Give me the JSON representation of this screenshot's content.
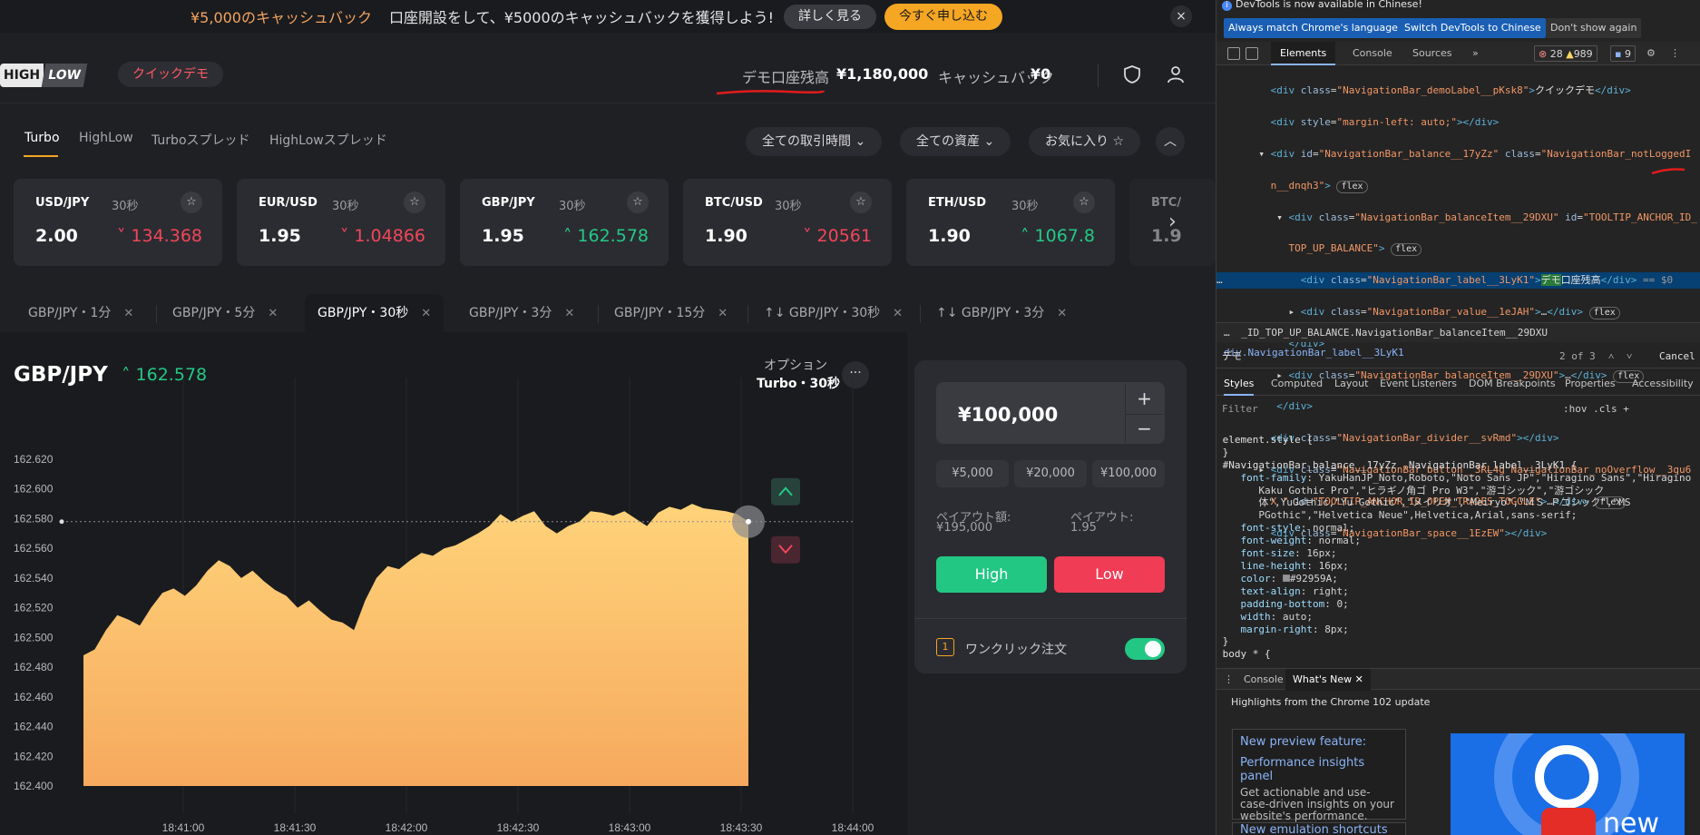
{
  "promo": {
    "cashback_amount": "¥5,000のキャッシュバック",
    "message": "口座開設をして、¥5000のキャッシュバックを獲得しよう!",
    "details_button": "詳しく見る",
    "apply_button": "今すぐ申し込む",
    "close_icon": "×"
  },
  "nav": {
    "logo_left": "HIGH",
    "logo_right": "LOW",
    "demo_label": "クイックデモ",
    "balance_label": "デモ口座残高",
    "balance_value": "¥1,180,000",
    "cashback_label": "キャッシュバック",
    "cashback_value": "¥0",
    "icons": [
      "shield-icon",
      "user-icon"
    ]
  },
  "modes": {
    "items": [
      "Turbo",
      "HighLow",
      "Turboスプレッド",
      "HighLowスプレッド"
    ],
    "active": "Turbo",
    "filters": [
      "全ての取引時間",
      "全ての資産",
      "お気に入り"
    ],
    "filter_icons": [
      "chevron-down-icon",
      "chevron-down-icon",
      "star-icon"
    ]
  },
  "assets": [
    {
      "pair": "USD/JPY",
      "duration": "30秒",
      "payout": "2.00",
      "price": "134.368",
      "direction": "down"
    },
    {
      "pair": "EUR/USD",
      "duration": "30秒",
      "payout": "1.95",
      "price": "1.04866",
      "direction": "down"
    },
    {
      "pair": "GBP/JPY",
      "duration": "30秒",
      "payout": "1.95",
      "price": "162.578",
      "direction": "up"
    },
    {
      "pair": "BTC/USD",
      "duration": "30秒",
      "payout": "1.90",
      "price": "20561",
      "direction": "down"
    },
    {
      "pair": "ETH/USD",
      "duration": "30秒",
      "payout": "1.90",
      "price": "1067.8",
      "direction": "up"
    },
    {
      "pair": "BTC/",
      "duration": "",
      "payout": "1.9",
      "price": "",
      "direction": "down"
    }
  ],
  "tabs": [
    {
      "label": "GBP/JPY・1分",
      "active": false
    },
    {
      "label": "GBP/JPY・5分",
      "active": false
    },
    {
      "label": "GBP/JPY・30秒",
      "active": true
    },
    {
      "label": "GBP/JPY・3分",
      "active": false
    },
    {
      "label": "GBP/JPY・15分",
      "active": false
    },
    {
      "label": "↑↓ GBP/JPY・30秒",
      "active": false
    },
    {
      "label": "↑↓ GBP/JPY・3分",
      "active": false
    }
  ],
  "chart_header": {
    "symbol": "GBP/JPY",
    "price": "162.578",
    "option_label": "オプション",
    "option_value": "Turbo・30秒",
    "more_icon": "···"
  },
  "chart_data": {
    "type": "area",
    "title": "",
    "xlabel": "",
    "ylabel": "",
    "y_ticks": [
      "162.620",
      "162.600",
      "162.580",
      "162.560",
      "162.540",
      "162.520",
      "162.500",
      "162.480",
      "162.460",
      "162.440",
      "162.420",
      "162.400"
    ],
    "x_ticks": [
      "18:41:00",
      "18:41:30",
      "18:42:00",
      "18:42:30",
      "18:43:00",
      "18:43:30",
      "18:44:00"
    ],
    "ylim": [
      162.4,
      162.62
    ],
    "current_price": 162.578,
    "series": [
      {
        "values": [
          162.488,
          162.492,
          162.505,
          162.515,
          162.512,
          162.508,
          162.52,
          162.53,
          162.533,
          162.528,
          162.535,
          162.545,
          162.552,
          162.548,
          162.54,
          162.545,
          162.538,
          162.532,
          162.528,
          162.52,
          162.525,
          162.518,
          162.512,
          162.51,
          162.505,
          162.525,
          162.54,
          162.548,
          162.546,
          162.552,
          162.557,
          162.555,
          162.56,
          162.562,
          162.566,
          162.57,
          162.575,
          162.583,
          162.578,
          162.582,
          162.585,
          162.575,
          162.57,
          162.575,
          162.578,
          162.585,
          162.584,
          162.582,
          162.585,
          162.58,
          162.575,
          162.584,
          162.588,
          162.586,
          162.59,
          162.587,
          162.586,
          162.585,
          162.583,
          162.578
        ]
      }
    ]
  },
  "trade": {
    "amount": "¥100,000",
    "plus_icon": "+",
    "minus_icon": "−",
    "presets": [
      "¥5,000",
      "¥20,000",
      "¥100,000"
    ],
    "payout_amount_label": "ペイアウト額:",
    "payout_amount": "¥195,000",
    "payout_rate_label": "ペイアウト:",
    "payout_rate": "1.95",
    "high_label": "High",
    "low_label": "Low",
    "one_click_label": "ワンクリック注文",
    "one_click_icon": "1"
  },
  "devtools": {
    "info": "DevTools is now available in Chinese!",
    "lang_buttons": [
      "Always match Chrome's language",
      "Switch DevTools to Chinese",
      "Don't show again"
    ],
    "tabs": [
      "Elements",
      "Console",
      "Sources",
      "»"
    ],
    "errors": "28",
    "warnings": "989",
    "messages": "9",
    "breadcrumb_left": "…",
    "breadcrumb_mid": "_ID_TOP_UP_BALANCE.NavigationBar_balanceItem__29DXU",
    "breadcrumb_right": "div.NavigationBar_label__3LyK1",
    "search_text": "デモ",
    "search_count": "2 of 3",
    "search_cancel": "Cancel",
    "style_tabs": [
      "Styles",
      "Computed",
      "Layout",
      "Event Listeners",
      "DOM Breakpoints",
      "Properties",
      "Accessibility"
    ],
    "filter_placeholder": "Filter",
    "filter_tools": ":hov  .cls  +",
    "drawer_tabs": [
      "Console",
      "What's New"
    ],
    "highlights": "Highlights from the Chrome 102 update",
    "news1_title": "New preview feature:",
    "news1_sub": "Performance insights panel",
    "news1_desc": "Get actionable and use-case-driven insights on your website's performance.",
    "news2_title": "New emulation shortcuts in",
    "news_img_text": "new"
  }
}
